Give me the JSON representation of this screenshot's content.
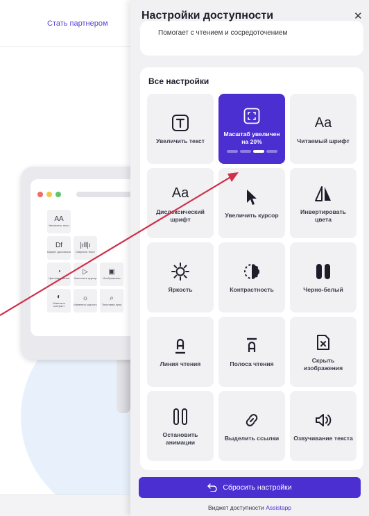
{
  "site": {
    "partner_link": "Стать партнером",
    "mini_tiles": [
      {
        "icon": "AA",
        "label": "Увеличить текст"
      },
      {
        "icon": "",
        "label": ""
      },
      {
        "icon": "",
        "label": ""
      },
      {
        "icon": "Df",
        "label": "Шрифт дислексии"
      },
      {
        "icon": "|ıll|ı",
        "label": "Озвучить текст"
      },
      {
        "icon": "",
        "label": ""
      },
      {
        "icon": "◔",
        "label": "Цветовая схема"
      },
      {
        "icon": "▷",
        "label": "Увеличить курсор"
      },
      {
        "icon": "▣",
        "label": "Изображения"
      },
      {
        "icon": "◐",
        "label": "Изменить контраст"
      },
      {
        "icon": "☼",
        "label": "Изменить яркость"
      },
      {
        "icon": "⌕",
        "label": "Текстовая лупа"
      }
    ]
  },
  "panel": {
    "title": "Настройки доступности",
    "close_icon": "close-icon",
    "info_text": "Помогает с чтением и сосредоточением",
    "settings_title": "Все настройки",
    "tiles": [
      {
        "label": "Увеличить текст",
        "icon": "text-size-icon"
      },
      {
        "label": "Масштаб увеличен на 20%",
        "icon": "zoom-icon",
        "active": true,
        "progress_level": 3,
        "progress_total": 4
      },
      {
        "label": "Читаемый шрифт",
        "icon": "readable-font-icon",
        "glyph": "Aa"
      },
      {
        "label": "Дислексический шрифт",
        "icon": "dyslexia-font-icon",
        "glyph": "Aa"
      },
      {
        "label": "Увеличить курсор",
        "icon": "cursor-icon"
      },
      {
        "label": "Инвертировать цвета",
        "icon": "invert-colors-icon"
      },
      {
        "label": "Яркость",
        "icon": "brightness-icon"
      },
      {
        "label": "Контрастность",
        "icon": "contrast-icon"
      },
      {
        "label": "Черно-белый",
        "icon": "grayscale-icon"
      },
      {
        "label": "Линия чтения",
        "icon": "reading-line-icon"
      },
      {
        "label": "Полоса чтения",
        "icon": "reading-mask-icon"
      },
      {
        "label": "Скрыть изображения",
        "icon": "hide-images-icon"
      },
      {
        "label": "Остановить анимации",
        "icon": "stop-animations-icon"
      },
      {
        "label": "Выделить ссылки",
        "icon": "link-icon"
      },
      {
        "label": "Озвучивание текста",
        "icon": "speaker-icon"
      }
    ],
    "reset_label": "Сбросить настройки",
    "footer_text": "Виджет доступности",
    "footer_brand": "Assistapp"
  },
  "colors": {
    "accent": "#4b2fd0",
    "panel_bg": "#f1f1f4",
    "arrow": "#d0304a"
  }
}
